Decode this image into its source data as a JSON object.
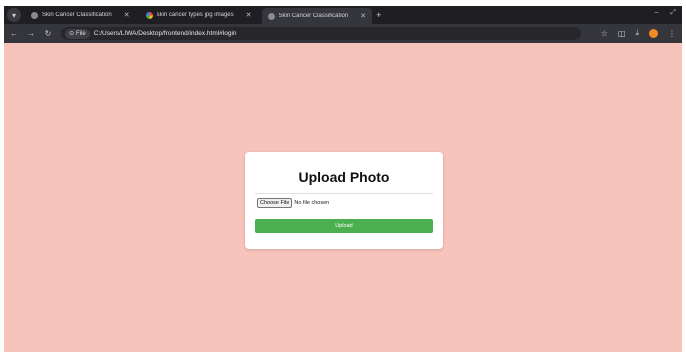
{
  "browser": {
    "tabs": [
      {
        "label": "Skin Cancer Classification",
        "favicon": "page-icon",
        "active": false
      },
      {
        "label": "skin cancer types jpg images",
        "favicon": "google-icon",
        "active": false
      },
      {
        "label": "Skin Cancer Classification",
        "favicon": "page-icon",
        "active": true
      }
    ],
    "new_tab_glyph": "+",
    "address": {
      "chip_label": "File",
      "url": "C:/Users/LIWA/Desktop/frontend/index.html#login"
    }
  },
  "card": {
    "title": "Upload Photo",
    "choose_file_label": "Choose File",
    "file_status": "No file chosen",
    "upload_label": "Upload"
  },
  "colors": {
    "page_background": "#f6c4bb",
    "upload_button": "#4caf50",
    "browser_chrome": "#1f1f23"
  }
}
